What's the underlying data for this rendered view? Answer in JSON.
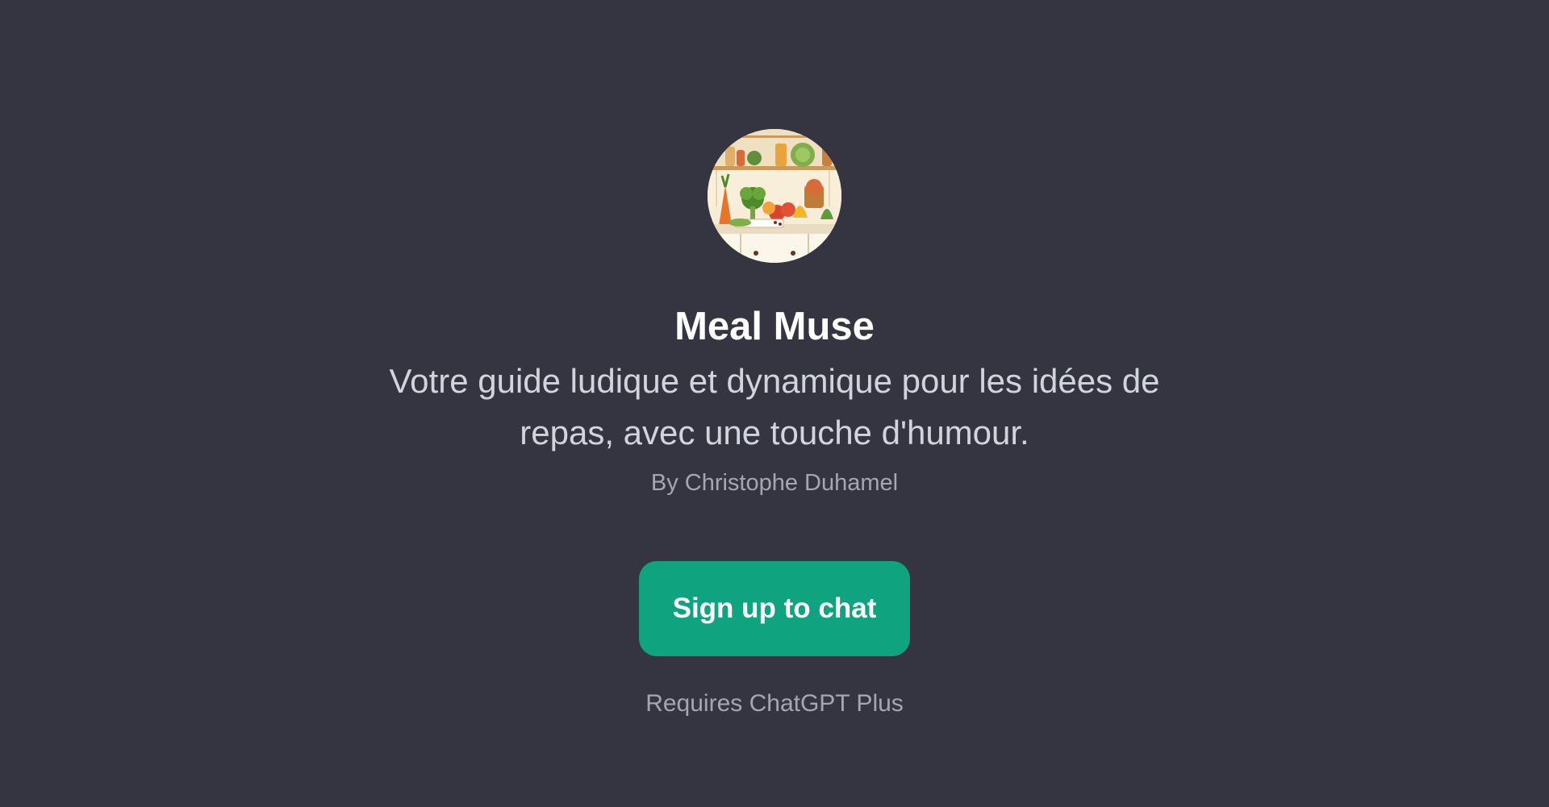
{
  "gpt": {
    "avatar_icon": "kitchen-vegetables-illustration",
    "name": "Meal Muse",
    "description": "Votre guide ludique et dynamique pour les idées de repas, avec une touche d'humour.",
    "author": "By Christophe Duhamel"
  },
  "cta": {
    "label": "Sign up to chat",
    "color": "#10a37f"
  },
  "footer": {
    "requirement": "Requires ChatGPT Plus"
  },
  "theme": {
    "background": "#343541"
  }
}
